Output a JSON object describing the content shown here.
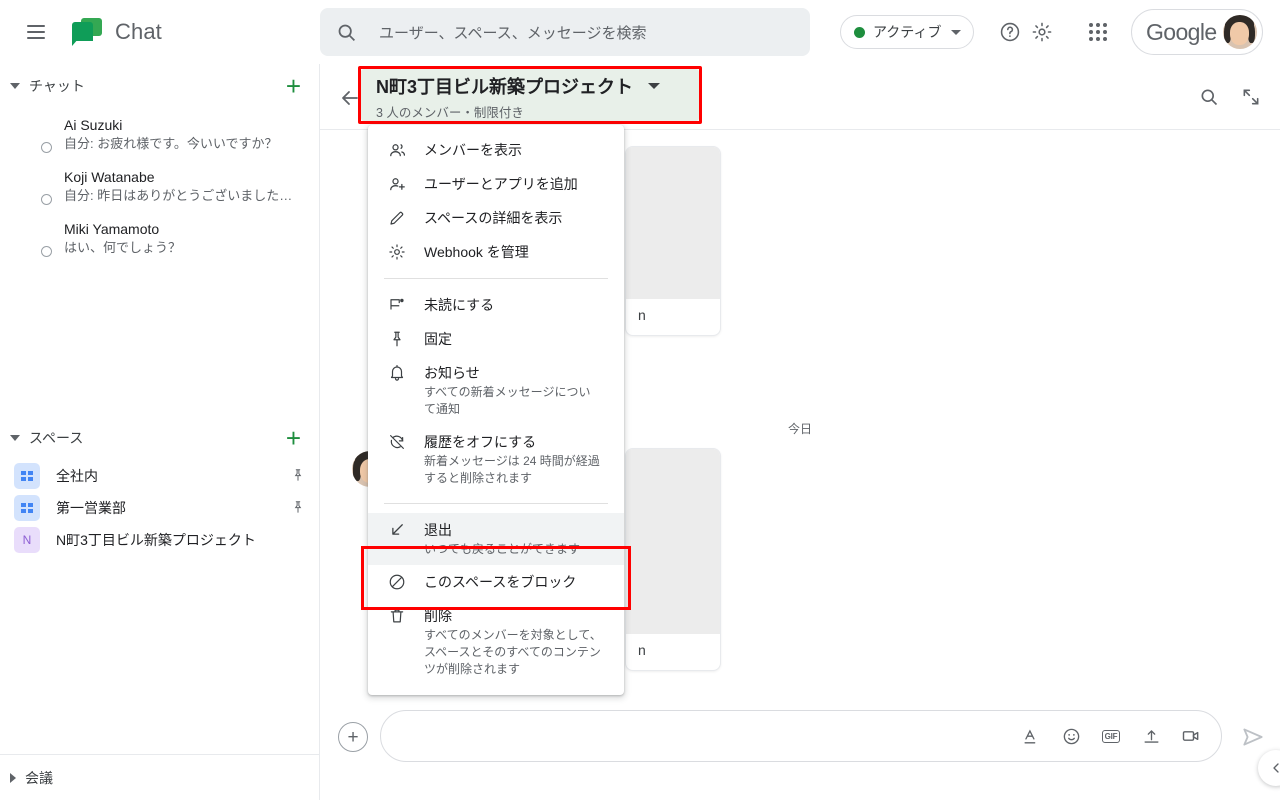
{
  "topbar": {
    "menu_icon": "hamburger-icon",
    "app_name": "Chat",
    "search": {
      "icon": "search-icon",
      "placeholder": "ユーザー、スペース、メッセージを検索",
      "value": ""
    },
    "presence": {
      "label": "アクティブ",
      "dot_color": "#1e8e3e"
    },
    "help_icon": "help-icon",
    "settings_icon": "gear-icon",
    "apps_icon": "apps-grid-icon",
    "account": {
      "brand": "Google",
      "avatar": "user-avatar"
    }
  },
  "sidebar": {
    "chat_section": {
      "title": "チャット",
      "add_label": "+",
      "items": [
        {
          "name": "Ai Suzuki",
          "snippet": "自分: お疲れ様です。今いいですか？"
        },
        {
          "name": "Koji Watanabe",
          "snippet": "自分: 昨日はありがとうございました…"
        },
        {
          "name": "Miki Yamamoto",
          "snippet": "はい、何でしょう？"
        }
      ]
    },
    "spaces_section": {
      "title": "スペース",
      "add_label": "+",
      "items": [
        {
          "name": "全社内",
          "icon": "grid-space-icon",
          "pinned": true,
          "pin_icon": "pin-icon",
          "initial": ""
        },
        {
          "name": "第一営業部",
          "icon": "grid-space-icon",
          "pinned": true,
          "pin_icon": "pin-icon",
          "initial": ""
        },
        {
          "name": "N町3丁目ビル新築プロジェクト",
          "icon": "letter-space-icon",
          "pinned": false,
          "pin_icon": "",
          "initial": "N"
        }
      ]
    },
    "meet_section": {
      "title": "会議"
    }
  },
  "conversation": {
    "back_icon": "back-arrow-icon",
    "title": "N町3丁目ビル新築プロジェクト",
    "dropdown_icon": "chevron-down-icon",
    "subtitle": "3 人のメンバー・制限付き",
    "search_icon": "search-icon",
    "collapse_icon": "collapse-icon",
    "day_divider": "今日",
    "cards": [
      {
        "caption": "n"
      },
      {
        "caption": "n"
      }
    ]
  },
  "composer": {
    "add_icon": "plus-circle-icon",
    "placeholder": "",
    "icons": [
      {
        "name": "format-text-icon",
        "glyph": "A"
      },
      {
        "name": "emoji-icon",
        "glyph": "☺"
      },
      {
        "name": "gif-icon",
        "glyph": "GIF"
      },
      {
        "name": "upload-icon",
        "glyph": "↥"
      },
      {
        "name": "video-icon",
        "glyph": "▭"
      }
    ],
    "send_icon": "send-icon"
  },
  "collapse_fab": {
    "icon": "chevron-left-icon"
  },
  "space_menu": {
    "groups": [
      {
        "items": [
          {
            "icon": "people-icon",
            "label": "メンバーを表示",
            "desc": ""
          },
          {
            "icon": "person-add-icon",
            "label": "ユーザーとアプリを追加",
            "desc": ""
          },
          {
            "icon": "pencil-icon",
            "label": "スペースの詳細を表示",
            "desc": ""
          },
          {
            "icon": "gear-icon",
            "label": "Webhook を管理",
            "desc": ""
          }
        ]
      },
      {
        "items": [
          {
            "icon": "mark-unread-icon",
            "label": "未読にする",
            "desc": ""
          },
          {
            "icon": "pin-icon",
            "label": "固定",
            "desc": ""
          },
          {
            "icon": "bell-icon",
            "label": "お知らせ",
            "desc": "すべての新着メッセージについて通知"
          },
          {
            "icon": "history-off-icon",
            "label": "履歴をオフにする",
            "desc": "新着メッセージは 24 時間が経過すると削除されます"
          }
        ]
      },
      {
        "items": [
          {
            "icon": "leave-icon",
            "label": "退出",
            "desc": "いつでも戻ることができます",
            "highlighted": true
          },
          {
            "icon": "block-icon",
            "label": "このスペースをブロック",
            "desc": ""
          },
          {
            "icon": "trash-icon",
            "label": "削除",
            "desc": "すべてのメンバーを対象として、スペースとそのすべてのコンテンツが削除されます"
          }
        ]
      }
    ]
  },
  "highlights": {
    "color": "#ff0000"
  }
}
